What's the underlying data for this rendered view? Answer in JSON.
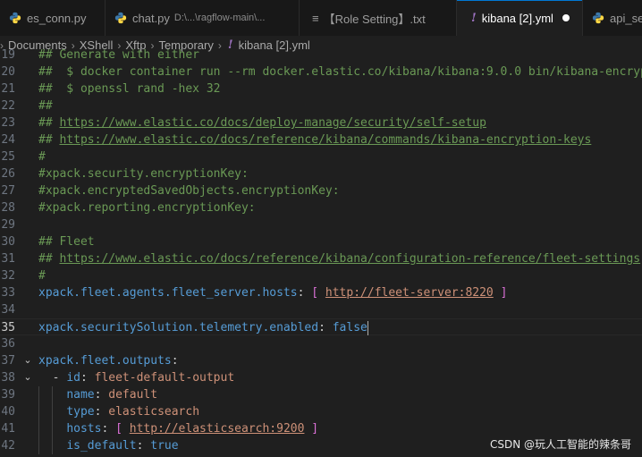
{
  "tabs": [
    {
      "label": "es_conn.py",
      "description": "",
      "icon": "python-icon",
      "active": false
    },
    {
      "label": "chat.py",
      "description": "D:\\...\\ragflow-main\\...",
      "icon": "python-icon",
      "active": false
    },
    {
      "label": "【Role Setting】.txt",
      "description": "",
      "icon": "text-file-icon",
      "active": false
    },
    {
      "label": "kibana [2].yml",
      "description": "",
      "icon": "yaml-icon",
      "active": true,
      "modified": true
    },
    {
      "label": "api_se",
      "description": "",
      "icon": "python-icon",
      "active": false
    }
  ],
  "breadcrumb": [
    "Documents",
    "XShell",
    "Xftp",
    "Temporary",
    "kibana [2].yml"
  ],
  "lines": [
    {
      "n": "19",
      "text": "## Generate with either"
    },
    {
      "n": "20",
      "text": "##  $ docker container run --rm docker.elastic.co/kibana/kibana:9.0.0 bin/kibana-encryption-keys generate"
    },
    {
      "n": "21",
      "text": "##  $ openssl rand -hex 32"
    },
    {
      "n": "22",
      "text": "##"
    },
    {
      "n": "23",
      "prefix": "## ",
      "link": "https://www.elastic.co/docs/deploy-manage/security/self-setup"
    },
    {
      "n": "24",
      "prefix": "## ",
      "link": "https://www.elastic.co/docs/reference/kibana/commands/kibana-encryption-keys"
    },
    {
      "n": "25",
      "text": "#"
    },
    {
      "n": "26",
      "text": "#xpack.security.encryptionKey:"
    },
    {
      "n": "27",
      "text": "#xpack.encryptedSavedObjects.encryptionKey:"
    },
    {
      "n": "28",
      "text": "#xpack.reporting.encryptionKey:"
    },
    {
      "n": "29",
      "text": ""
    },
    {
      "n": "30",
      "text": "## Fleet"
    },
    {
      "n": "31",
      "prefix": "## ",
      "link": "https://www.elastic.co/docs/reference/kibana/configuration-reference/fleet-settings"
    },
    {
      "n": "32",
      "text": "#"
    },
    {
      "n": "33",
      "key": "xpack.fleet.agents.fleet_server.hosts",
      "url": "http://fleet-server:8220"
    },
    {
      "n": "34",
      "text": ""
    },
    {
      "n": "35",
      "key": "xpack.securitySolution.telemetry.enabled",
      "value": "false"
    },
    {
      "n": "36",
      "text": ""
    },
    {
      "n": "37",
      "key": "xpack.fleet.outputs"
    },
    {
      "n": "38",
      "key": "id",
      "value": "fleet-default-output"
    },
    {
      "n": "39",
      "key": "name",
      "value": "default"
    },
    {
      "n": "40",
      "key": "type",
      "value": "elasticsearch"
    },
    {
      "n": "41",
      "key": "hosts",
      "url": "http://elasticsearch:9200"
    },
    {
      "n": "42",
      "key": "is_default",
      "value": "true"
    }
  ],
  "watermark": "CSDN @玩人工智能的辣条哥",
  "colors": {
    "accent": "#0078d4",
    "comment": "#6a9955",
    "key": "#569cd6",
    "string": "#ce9178",
    "bracket": "#da70d6"
  }
}
